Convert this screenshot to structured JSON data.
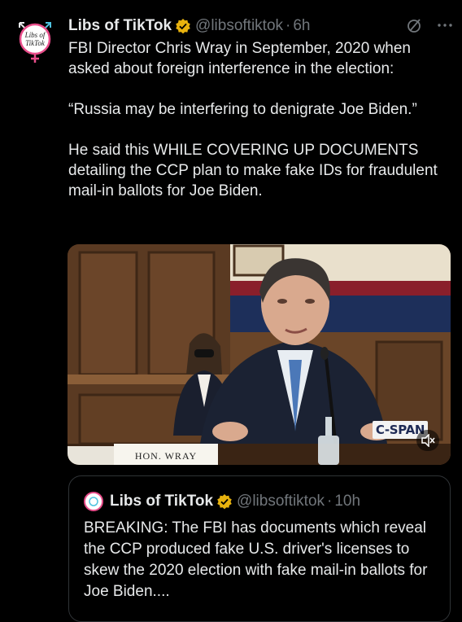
{
  "tweet": {
    "author_name": "Libs of TikTok",
    "handle": "@libsoftiktok",
    "separator": "·",
    "time": "6h",
    "avatar_label_line1": "Libs of",
    "avatar_label_line2": "TikTok",
    "paragraphs": [
      "FBI Director Chris Wray in September, 2020 when asked about foreign interference in the election:",
      "“Russia may be interfering to denigrate Joe Biden.”",
      "He said this WHILE COVERING UP DOCUMENTS detailing the CCP plan to make fake IDs for fraudulent mail-in ballots for Joe Biden."
    ]
  },
  "media": {
    "broadcaster_logo": "C-SPAN",
    "nameplate": "HON. WRAY",
    "mute_icon": "speaker-muted-icon"
  },
  "quoted_tweet": {
    "author_name": "Libs of TikTok",
    "handle": "@libsoftiktok",
    "separator": "·",
    "time": "10h",
    "text": "BREAKING: The FBI has documents which reveal the CCP produced fake U.S. driver's licenses to skew the 2020 election with fake mail-in ballots for Joe Biden...."
  },
  "icons": {
    "verified": "verified-badge-icon",
    "grok": "slash-circle-icon",
    "more": "more-dots-icon"
  },
  "colors": {
    "background": "#000000",
    "text": "#e7e9ea",
    "secondary_text": "#71767b",
    "verified_badge": "#e8b20e",
    "border": "#2f3336"
  }
}
